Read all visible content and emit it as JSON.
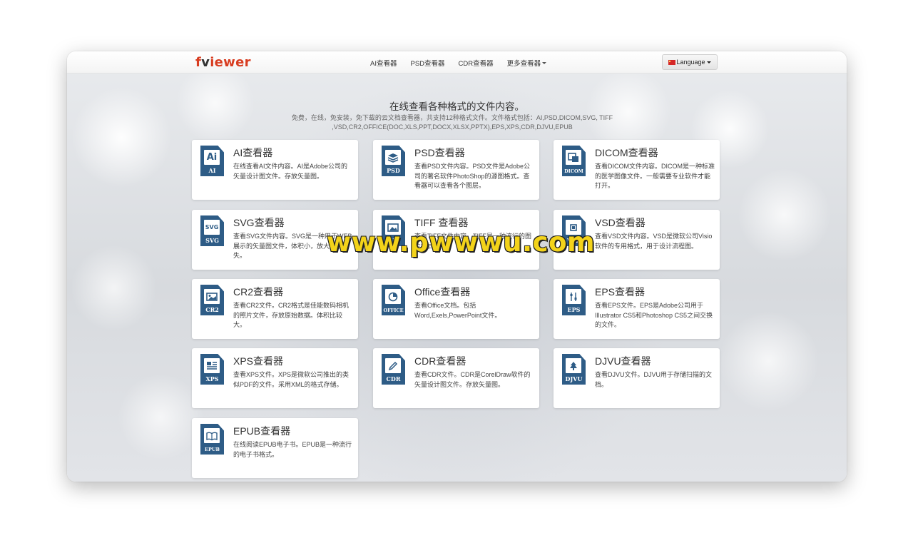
{
  "brand": {
    "logo_a": "f",
    "logo_b": "v",
    "logo_c": "iewer"
  },
  "nav": {
    "links": [
      {
        "label": "AI查看器"
      },
      {
        "label": "PSD查看器"
      },
      {
        "label": "CDR查看器"
      },
      {
        "label": "更多查看器"
      }
    ],
    "language": "Language"
  },
  "hero": {
    "title": "在线查看各种格式的文件内容。",
    "subtitle": "免费，在线，免安装，免下载的云文档查看器，共支持12种格式文件。文件格式包括：AI,PSD,DICOM,SVG, TIFF ,VSD,CR2,OFFICE(DOC,XLS,PPT,DOCX,XLSX,PPTX),EPS,XPS,CDR,DJVU,EPUB"
  },
  "cards": [
    {
      "title": "AI查看器",
      "desc": "在线查看AI文件内容。AI是Adobe公司的矢量设计图文件。存放矢量图。",
      "ext": "AI",
      "glyph": "Ai"
    },
    {
      "title": "PSD查看器",
      "desc": "查看PSD文件内容。PSD文件是Adobe公司的著名软件PhotoShop的源图格式。查看器可以查看各个图层。",
      "ext": "PSD"
    },
    {
      "title": "DICOM查看器",
      "desc": "查看DICOM文件内容。DICOM是一种标准的医学图像文件。一般需要专业软件才能打开。",
      "ext": "DICOM"
    },
    {
      "title": "SVG查看器",
      "desc": "查看SVG文件内容。SVG是一种用于WEB 展示的矢量图文件，体积小，放大无损失。",
      "ext": "SVG",
      "glyph": "SVG"
    },
    {
      "title": "TIFF 查看器",
      "desc": "查看TIFF文件内容。TIFF是一种流行的图片格式。",
      "ext": "TIFF"
    },
    {
      "title": "VSD查看器",
      "desc": "查看VSD文件内容。VSD是微软公司Visio软件的专用格式，用于设计流程图。",
      "ext": "VSD"
    },
    {
      "title": "CR2查看器",
      "desc": "查看CR2文件。CR2格式是佳能数码相机的照片文件，存放原始数据。体积比较大。",
      "ext": "CR2"
    },
    {
      "title": "Office查看器",
      "desc": "查看Office文档。包括Word,Exels,PowerPoint文件。",
      "ext": "OFFICE"
    },
    {
      "title": "EPS查看器",
      "desc": "查看EPS文件。EPS是Adobe公司用于Illustrator CS5和Photoshop CS5之间交换的文件。",
      "ext": "EPS"
    },
    {
      "title": "XPS查看器",
      "desc": "查看XPS文件。XPS是微软公司推出的类似PDF的文件。采用XML的格式存储。",
      "ext": "XPS"
    },
    {
      "title": "CDR查看器",
      "desc": "查看CDR文件。CDR是CorelDraw软件的矢量设计图文件。存放矢量图。",
      "ext": "CDR"
    },
    {
      "title": "DJVU查看器",
      "desc": "查看DJVU文件。DJVU用于存储扫描的文档。",
      "ext": "DJVU"
    },
    {
      "title": "EPUB查看器",
      "desc": "在线阅读EPUB电子书。EPUB是一种流行的电子书格式。",
      "ext": "EPUB"
    }
  ],
  "icons": [
    "ai-file-icon",
    "psd-file-icon",
    "dicom-file-icon",
    "svg-file-icon",
    "tiff-file-icon",
    "vsd-file-icon",
    "cr2-file-icon",
    "office-file-icon",
    "eps-file-icon",
    "xps-file-icon",
    "cdr-file-icon",
    "djvu-file-icon",
    "epub-file-icon"
  ],
  "colors": {
    "icon_blue": "#2e5c86",
    "logo_red": "#d83d21",
    "watermark_yellow": "#f3d31a"
  },
  "watermark": "www.pwwwu.com"
}
